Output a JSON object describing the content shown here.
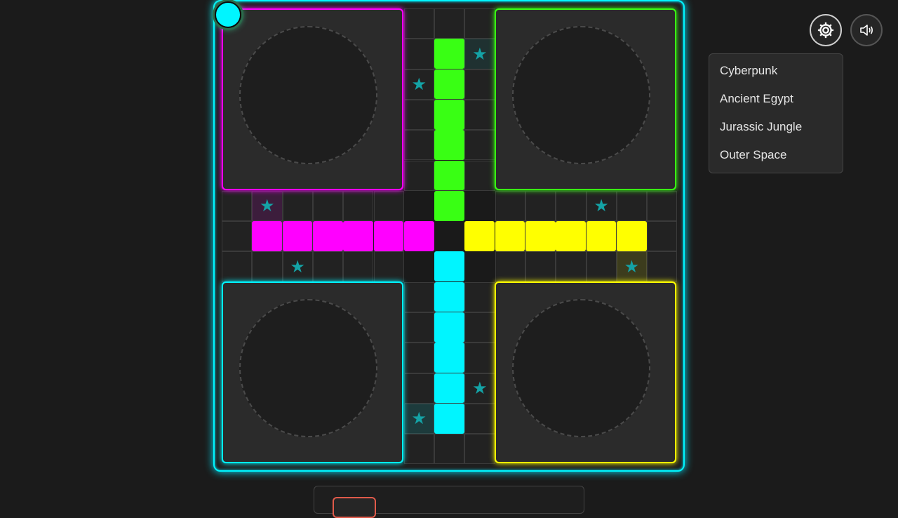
{
  "colors": {
    "cyan": "#00f5ff",
    "magenta": "#ff00ff",
    "green": "#39ff14",
    "yellow": "#ffff00",
    "star": "#14a3a6",
    "board_glow": "#00e5ff"
  },
  "board": {
    "players": [
      "magenta",
      "green",
      "cyan",
      "yellow"
    ],
    "current_token_color": "cyan"
  },
  "controls": {
    "settings_icon": "gear-icon",
    "sound_icon": "speaker-icon"
  },
  "theme_menu": {
    "items": [
      "Cyberpunk",
      "Ancient Egypt",
      "Jurassic Jungle",
      "Outer Space"
    ]
  }
}
